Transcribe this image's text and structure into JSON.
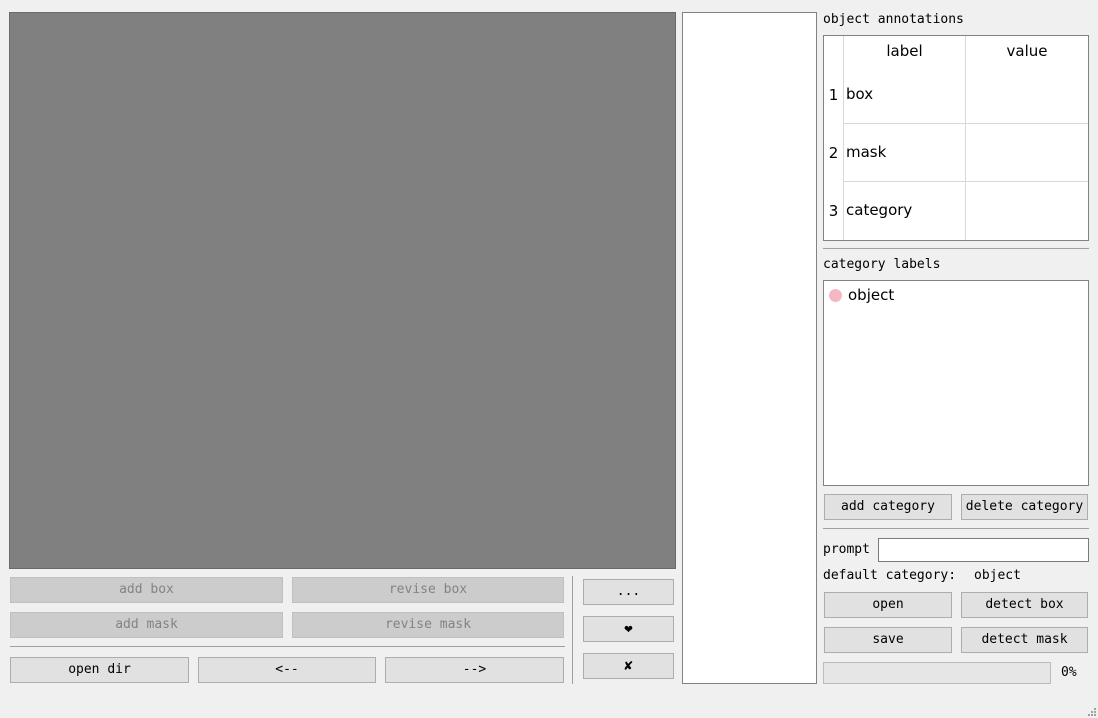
{
  "canvas": {
    "background_color": "#808080"
  },
  "edit_buttons": {
    "add_box": "add box",
    "revise_box": "revise box",
    "add_mask": "add mask",
    "revise_mask": "revise mask"
  },
  "nav_buttons": {
    "open_dir": "open dir",
    "prev": "<--",
    "next": "-->"
  },
  "side_buttons": {
    "more": "...",
    "favorite": "❤",
    "delete": "✘"
  },
  "annotations": {
    "title": "object annotations",
    "columns": [
      "label",
      "value"
    ],
    "rows": [
      {
        "index": "1",
        "label": "box",
        "value": ""
      },
      {
        "index": "2",
        "label": "mask",
        "value": ""
      },
      {
        "index": "3",
        "label": "category",
        "value": ""
      }
    ]
  },
  "categories": {
    "title": "category labels",
    "items": [
      {
        "name": "object",
        "color": "#f4b8c4"
      }
    ],
    "add_label": "add category",
    "delete_label": "delete category"
  },
  "prompt": {
    "label": "prompt",
    "value": ""
  },
  "default_category": {
    "label": "default category:",
    "value": "object"
  },
  "actions": {
    "open": "open",
    "detect_box": "detect box",
    "save": "save",
    "detect_mask": "detect mask"
  },
  "progress": {
    "value": 0,
    "text": "0%"
  }
}
